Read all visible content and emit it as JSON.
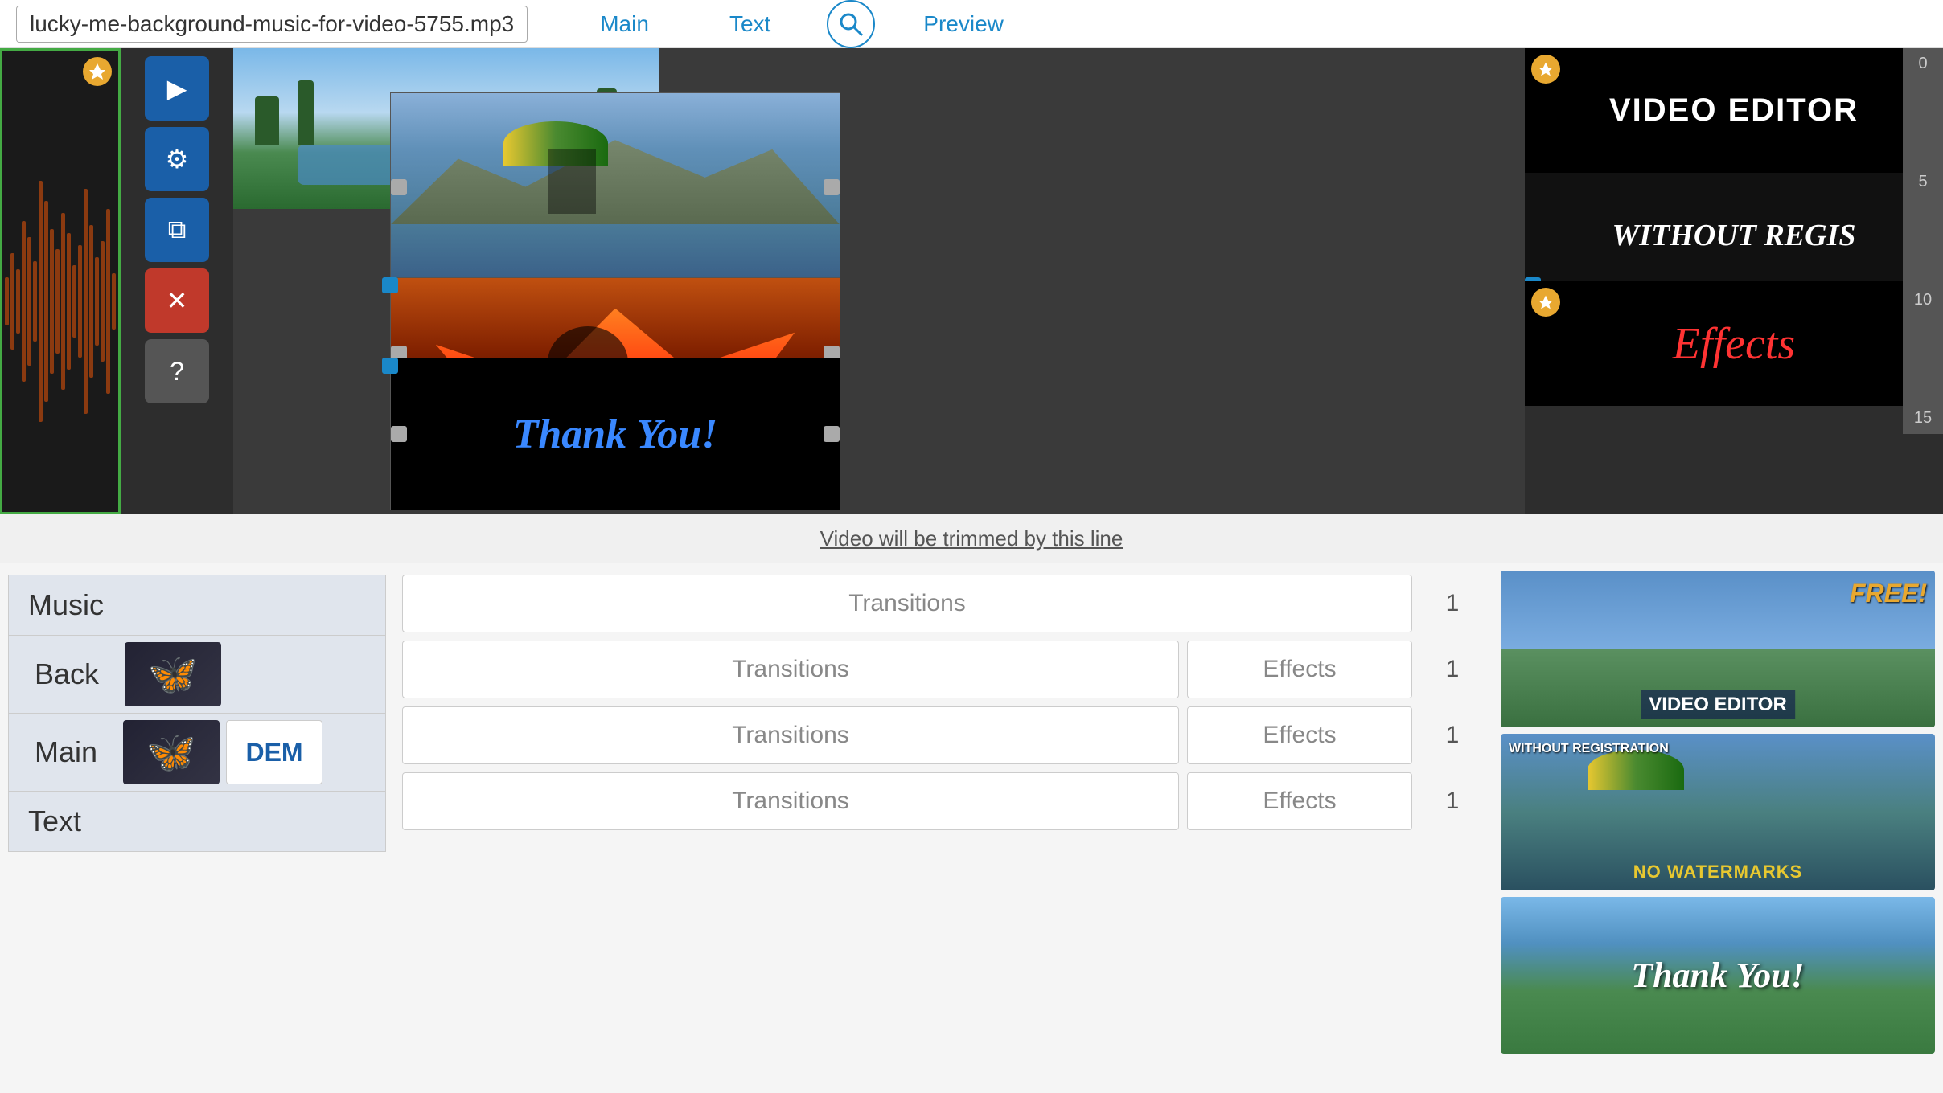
{
  "header": {
    "filename": "lucky-me-background-music-for-video-5755.mp3",
    "tabs": [
      "Main",
      "Text"
    ],
    "preview_label": "Preview"
  },
  "timeline": {
    "ruler_marks": [
      "0",
      "5",
      "10",
      "15"
    ],
    "trim_notice": "Video will be trimmed by this line"
  },
  "controls": {
    "play_icon": "▶",
    "settings_icon": "⚙",
    "copy_icon": "⧉",
    "delete_icon": "✕",
    "help_icon": "?"
  },
  "overlays": {
    "video_editor": "VIDEO EDITOR",
    "without_reg": "WITHOUT REGIS",
    "effects": "Effects"
  },
  "preview": {
    "free_badge": "FREE!",
    "video_editor_label": "VIDEO EDITOR",
    "no_watermarks": "NO WATERMARKS",
    "wind_reg": "WITHOUT REGISTRATION",
    "thank_you": "Thank You!"
  },
  "sidebar": {
    "buttons": [
      "Music",
      "Back",
      "Main",
      "Text"
    ],
    "thumbnails": [
      "butterfly",
      "butterfly",
      "DEM"
    ]
  },
  "transitions": {
    "rows": [
      {
        "transition": "Transitions",
        "effects": null,
        "number": "1"
      },
      {
        "transition": "Transitions",
        "effects": "Effects",
        "number": "1"
      },
      {
        "transition": "Transitions",
        "effects": "Effects",
        "number": "1"
      },
      {
        "transition": "Transitions",
        "effects": "Effects",
        "number": "1"
      }
    ]
  },
  "colors": {
    "accent": "#1a88c9",
    "btn_blue": "#1a5fa8",
    "btn_red": "#c0392b",
    "text_dark": "#333",
    "sidebar_bg": "#e0e5ed"
  }
}
